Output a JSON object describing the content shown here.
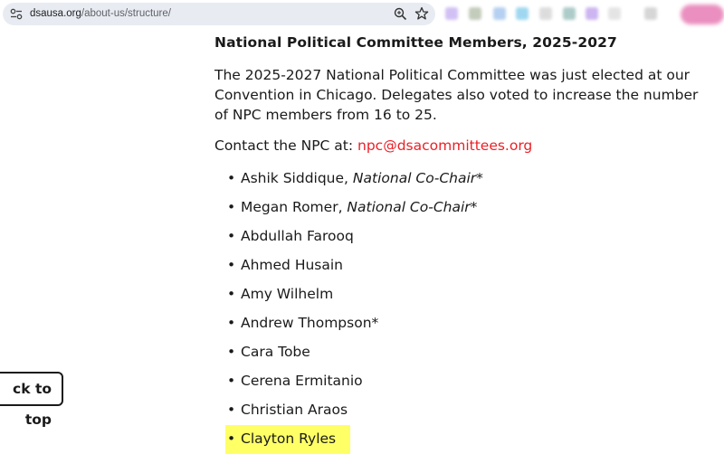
{
  "browser": {
    "url_host": "dsausa.org",
    "url_path": "/about-us/structure/",
    "icons": [
      "site-info-icon",
      "zoom-icon",
      "bookmark-star-icon"
    ]
  },
  "section": {
    "title": "National Political Committee Members, 2025-2027",
    "intro": "The 2025-2027 National Political Committee was just elected at our Convention in Chicago. Delegates also voted to increase the number of NPC members from 16 to 25.",
    "contact_label": "Contact the NPC at: ",
    "contact_email": "npc@dsacommittees.org"
  },
  "members": [
    {
      "name": "Ashik Siddique",
      "role": "National Co-Chair*"
    },
    {
      "name": "Megan Romer",
      "role": "National Co-Chair*"
    },
    {
      "name": "Abdullah Farooq"
    },
    {
      "name": "Ahmed Husain"
    },
    {
      "name": "Amy Wilhelm"
    },
    {
      "name": "Andrew Thompson*"
    },
    {
      "name": "Cara Tobe"
    },
    {
      "name": "Cerena Ermitanio"
    },
    {
      "name": "Christian Araos"
    },
    {
      "name": "Clayton Ryles",
      "highlighted": true
    }
  ],
  "back_to_top": "ck to top",
  "colors": {
    "link": "#ec1f27",
    "highlight": "#ffff66",
    "text": "#1a1a1a"
  }
}
